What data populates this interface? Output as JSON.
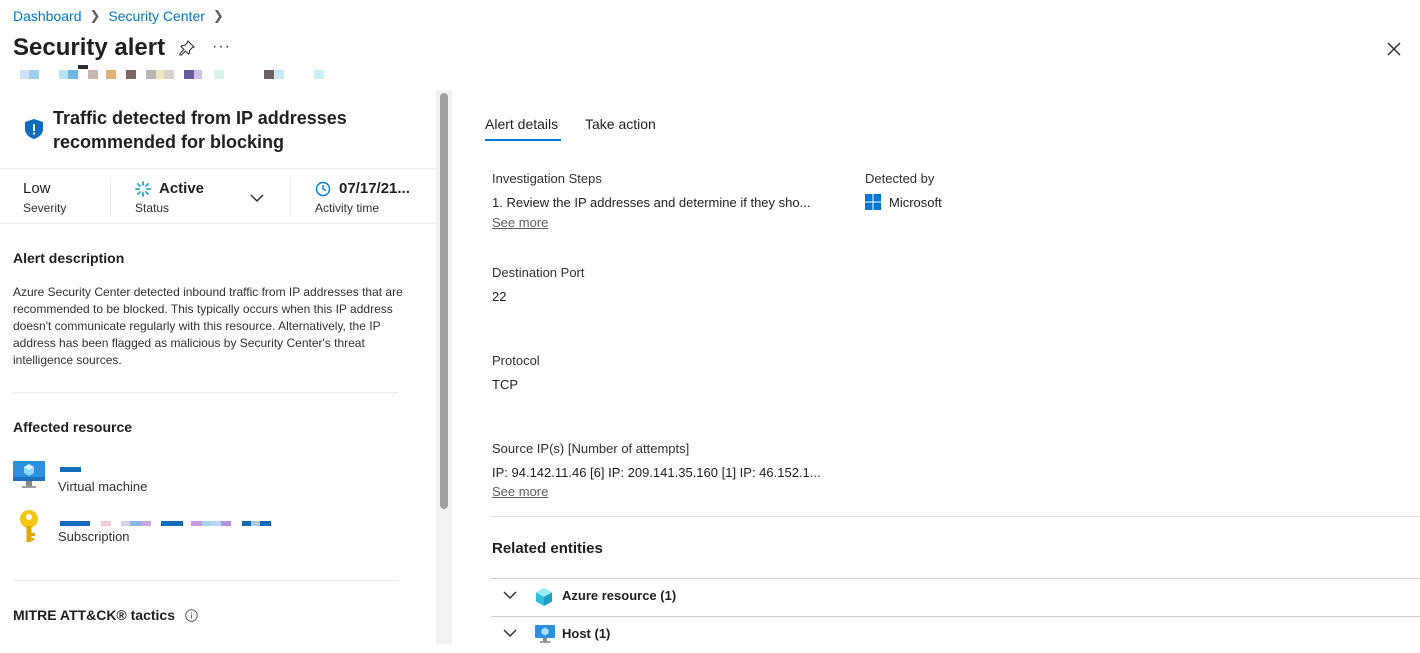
{
  "breadcrumb": {
    "items": [
      "Dashboard",
      "Security Center"
    ]
  },
  "header": {
    "title": "Security alert",
    "pin_icon": "pin-icon",
    "more_icon": "ellipsis-icon",
    "close_icon": "close-icon"
  },
  "alert": {
    "title": "Traffic detected from IP addresses recommended for blocking",
    "icon": "shield-icon",
    "severity": {
      "value": "Low",
      "label": "Severity"
    },
    "status": {
      "value": "Active",
      "label": "Status"
    },
    "activity": {
      "value": "07/17/21...",
      "label": "Activity time"
    }
  },
  "description": {
    "heading": "Alert description",
    "text": "Azure Security Center detected inbound traffic from IP addresses that are recommended to be blocked. This typically occurs when this IP address doesn't communicate regularly with this resource. Alternatively, the IP address has been flagged as malicious by Security Center's threat intelligence sources."
  },
  "affected": {
    "heading": "Affected resource",
    "items": [
      {
        "label": "Virtual machine",
        "icon": "virtual-machine-icon"
      },
      {
        "label": "Subscription",
        "icon": "key-icon"
      }
    ]
  },
  "mitre": {
    "heading": "MITRE ATT&CK® tactics",
    "icon": "info-icon"
  },
  "tabs": [
    {
      "label": "Alert details",
      "selected": true
    },
    {
      "label": "Take action",
      "selected": false
    }
  ],
  "details": {
    "investigation": {
      "label": "Investigation Steps",
      "value": "1. Review the IP addresses and determine if they sho...",
      "see_more": "See more"
    },
    "detected_by": {
      "label": "Detected by",
      "value": "Microsoft"
    },
    "port": {
      "label": "Destination Port",
      "value": "22"
    },
    "protocol": {
      "label": "Protocol",
      "value": "TCP"
    },
    "source": {
      "label": "Source IP(s) [Number of attempts]",
      "value": "IP: 94.142.11.46 [6] IP: 209.141.35.160 [1] IP: 46.152.1...",
      "see_more": "See more"
    }
  },
  "related": {
    "heading": "Related entities",
    "items": [
      {
        "label": "Azure resource (1)",
        "icon": "cube-icon"
      },
      {
        "label": "Host (1)",
        "icon": "host-icon"
      }
    ]
  },
  "colors": {
    "accent": "#0078d4",
    "text": "#323130",
    "border": "#edebe9"
  }
}
